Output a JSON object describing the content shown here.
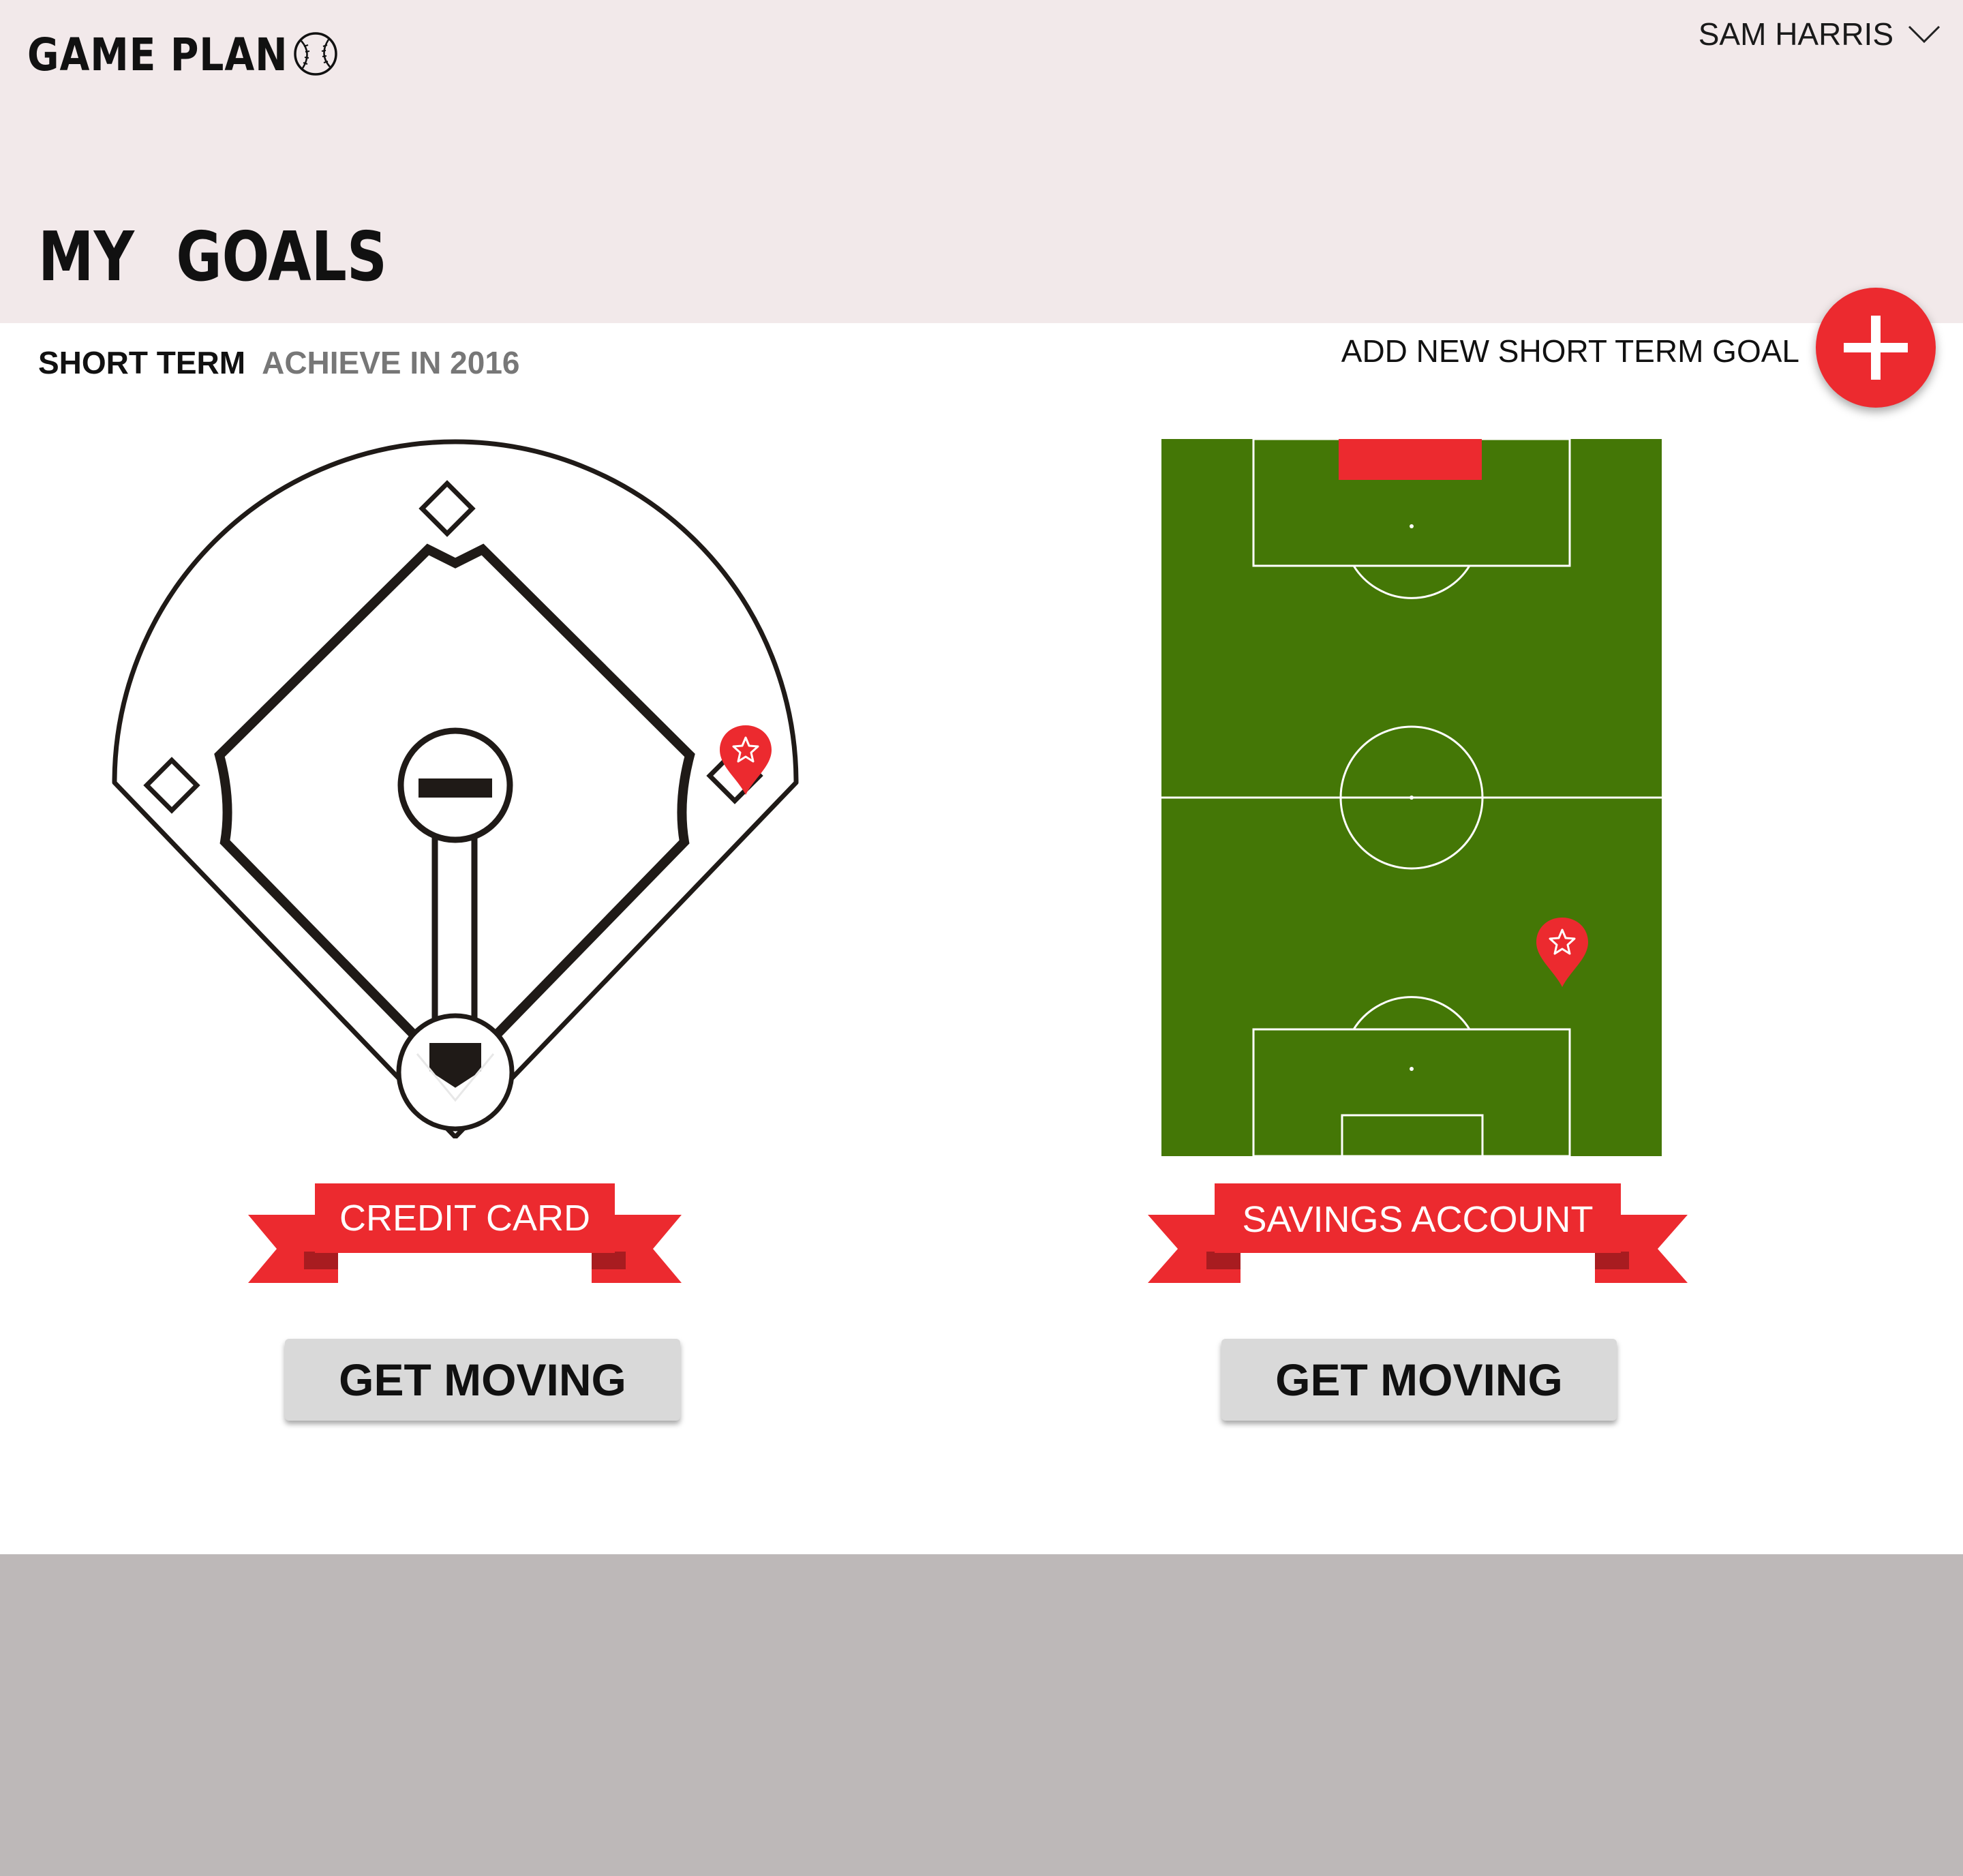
{
  "header": {
    "brand": "GAME PLAN",
    "user_name": "SAM HARRIS",
    "page_title": "MY GOALS"
  },
  "section": {
    "term": "SHORT TERM",
    "achieve": "ACHIEVE IN 2016",
    "add_label": "ADD NEW SHORT TERM GOAL"
  },
  "goals": [
    {
      "name": "CREDIT CARD",
      "field": "baseball",
      "action": "GET MOVING",
      "progress": 0.25
    },
    {
      "name": "SAVINGS ACCOUNT",
      "field": "soccer",
      "action": "GET MOVING",
      "progress": 0.75
    }
  ],
  "colors": {
    "accent": "#ec2a2f",
    "header_bg": "#f2e9ea",
    "footer_bg": "#bdb8b8",
    "pitch": "#447706",
    "button_bg": "#d9d9d9"
  },
  "icons": {
    "brand": "baseball-icon",
    "user_menu": "chevron-down-icon",
    "add": "plus-icon",
    "marker": "star-pin-icon"
  }
}
